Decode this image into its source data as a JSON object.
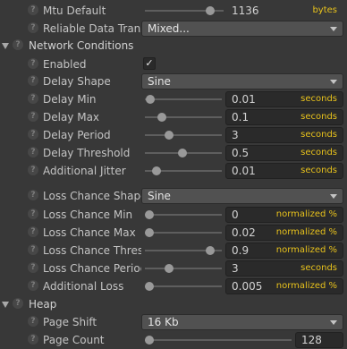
{
  "mtu_default": {
    "label": "Mtu Default",
    "value": "1136",
    "unit": "bytes",
    "slider_fraction": 0.87
  },
  "reliable_data_transport": {
    "label": "Reliable Data Trans",
    "value": "Mixed..."
  },
  "network_conditions": {
    "title": "Network Conditions",
    "enabled": {
      "label": "Enabled",
      "checked": true,
      "check_glyph": "✓"
    },
    "delay_shape": {
      "label": "Delay Shape",
      "value": "Sine"
    },
    "delay_min": {
      "label": "Delay Min",
      "value": "0.01",
      "unit": "seconds",
      "slider_fraction": 0.01
    },
    "delay_max": {
      "label": "Delay Max",
      "value": "0.1",
      "unit": "seconds",
      "slider_fraction": 0.19
    },
    "delay_period": {
      "label": "Delay Period",
      "value": "3",
      "unit": "seconds",
      "slider_fraction": 0.29
    },
    "delay_threshold": {
      "label": "Delay Threshold",
      "value": "0.5",
      "unit": "seconds",
      "slider_fraction": 0.49
    },
    "additional_jitter": {
      "label": "Additional Jitter",
      "value": "0.01",
      "unit": "seconds",
      "slider_fraction": 0.1
    },
    "loss_chance_shape": {
      "label": "Loss Chance Shape",
      "value": "Sine"
    },
    "loss_chance_min": {
      "label": "Loss Chance Min",
      "value": "0",
      "unit": "normalized %",
      "slider_fraction": 0.0
    },
    "loss_chance_max": {
      "label": "Loss Chance Max",
      "value": "0.02",
      "unit": "normalized %",
      "slider_fraction": 0.0
    },
    "loss_chance_threshold": {
      "label": "Loss Chance Thres",
      "value": "0.9",
      "unit": "normalized %",
      "slider_fraction": 0.9
    },
    "loss_chance_period": {
      "label": "Loss Chance Perioc",
      "value": "3",
      "unit": "seconds",
      "slider_fraction": 0.29
    },
    "additional_loss": {
      "label": "Additional Loss",
      "value": "0.005",
      "unit": "normalized %",
      "slider_fraction": 0.0
    }
  },
  "heap": {
    "title": "Heap",
    "page_shift": {
      "label": "Page Shift",
      "value": "16 Kb"
    },
    "page_count": {
      "label": "Page Count",
      "value": "128",
      "slider_fraction": 0.0
    }
  },
  "help_glyph": "?",
  "colors": {
    "background": "#383838",
    "unit_text": "#e8c21c",
    "field_bg": "#2a2a2a"
  }
}
